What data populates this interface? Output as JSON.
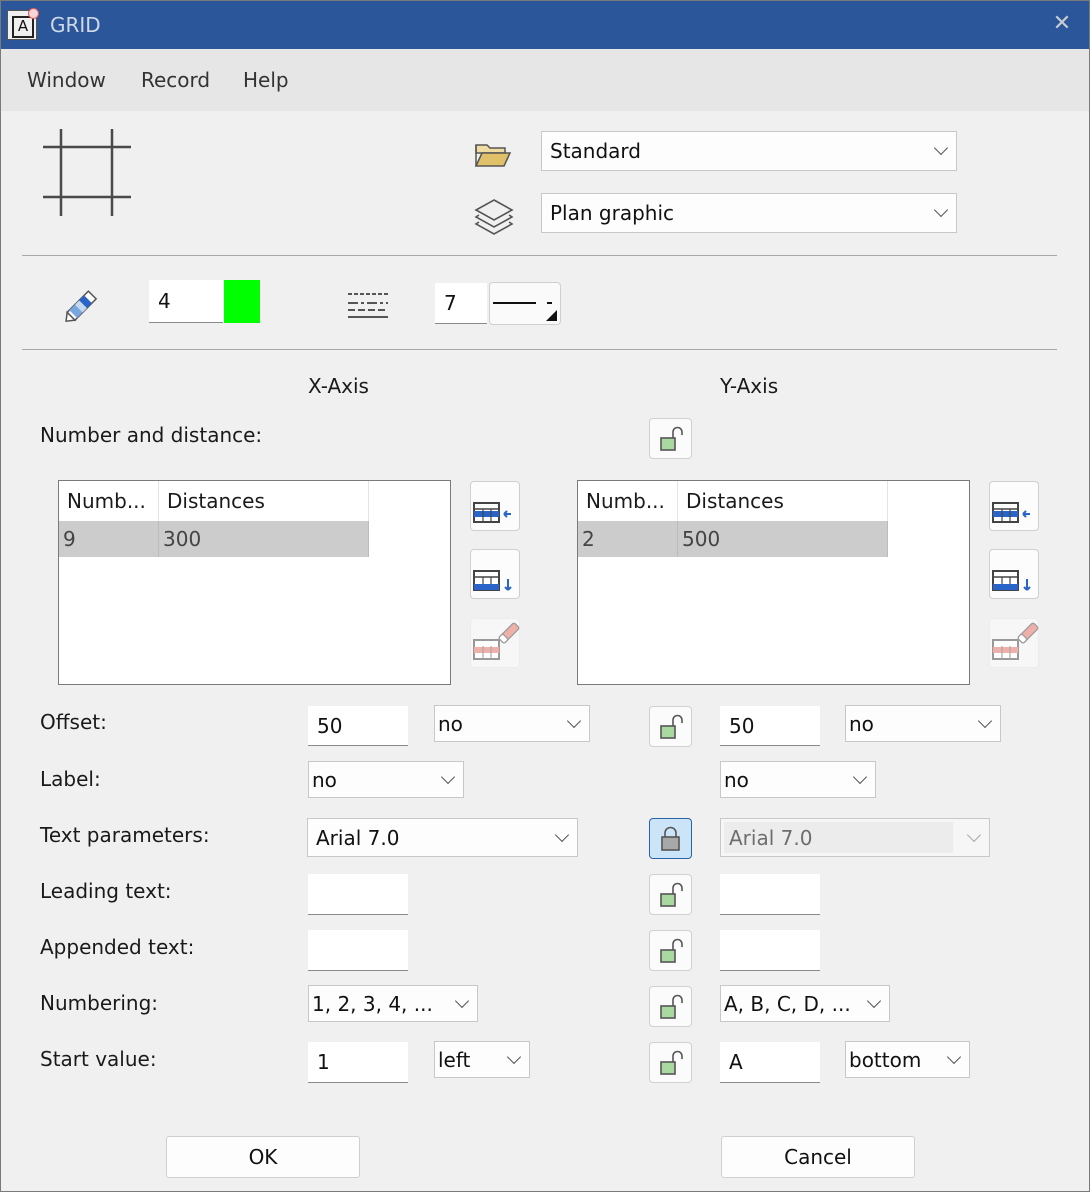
{
  "window": {
    "title": "GRID",
    "app_icon": "app-letter-a-icon",
    "close_icon": "close-icon"
  },
  "menu": {
    "items": [
      "Window",
      "Record",
      "Help"
    ]
  },
  "header": {
    "grid_icon": "grid-icon",
    "project_icon": "folder-open-icon",
    "project_value": "Standard",
    "layer_icon": "layers-icon",
    "layer_value": "Plan graphic"
  },
  "pen": {
    "pen_icon": "pencil-icon",
    "pen_value": "4",
    "color": "#00ff00",
    "linetype_icon": "line-type-icon",
    "linetype_value": "7",
    "linestyle_icon": "line-style-icon"
  },
  "axes": {
    "x_label": "X-Axis",
    "y_label": "Y-Axis"
  },
  "number_distance": {
    "label": "Number and distance:",
    "lock_state": "unlocked",
    "x_table": {
      "columns": [
        "Numb...",
        "Distances"
      ],
      "rows": [
        [
          "9",
          "300"
        ]
      ]
    },
    "y_table": {
      "columns": [
        "Numb...",
        "Distances"
      ],
      "rows": [
        [
          "2",
          "500"
        ]
      ]
    },
    "tools": {
      "insert": "table-insert-row-icon",
      "append": "table-append-row-icon",
      "delete": "table-delete-row-icon"
    }
  },
  "fields": {
    "offset": {
      "label": "Offset:",
      "x_value": "50",
      "x_option": "no",
      "y_value": "50",
      "y_option": "no",
      "lock": "unlocked"
    },
    "label": {
      "label": "Label:",
      "x_option": "no",
      "y_option": "no"
    },
    "text_params": {
      "label": "Text parameters:",
      "x_option": "Arial 7.0",
      "y_option": "Arial 7.0",
      "lock": "locked"
    },
    "leading_text": {
      "label": "Leading text:",
      "x_value": "",
      "y_value": "",
      "lock": "unlocked"
    },
    "appended_text": {
      "label": "Appended text:",
      "x_value": "",
      "y_value": "",
      "lock": "unlocked"
    },
    "numbering": {
      "label": "Numbering:",
      "x_option": "1, 2, 3, 4, ...",
      "y_option": "A, B, C, D, ...",
      "lock": "unlocked"
    },
    "start_value": {
      "label": "Start value:",
      "x_value": "1",
      "x_option": "left",
      "y_value": "A",
      "y_option": "bottom",
      "lock": "unlocked"
    }
  },
  "buttons": {
    "ok": "OK",
    "cancel": "Cancel"
  }
}
